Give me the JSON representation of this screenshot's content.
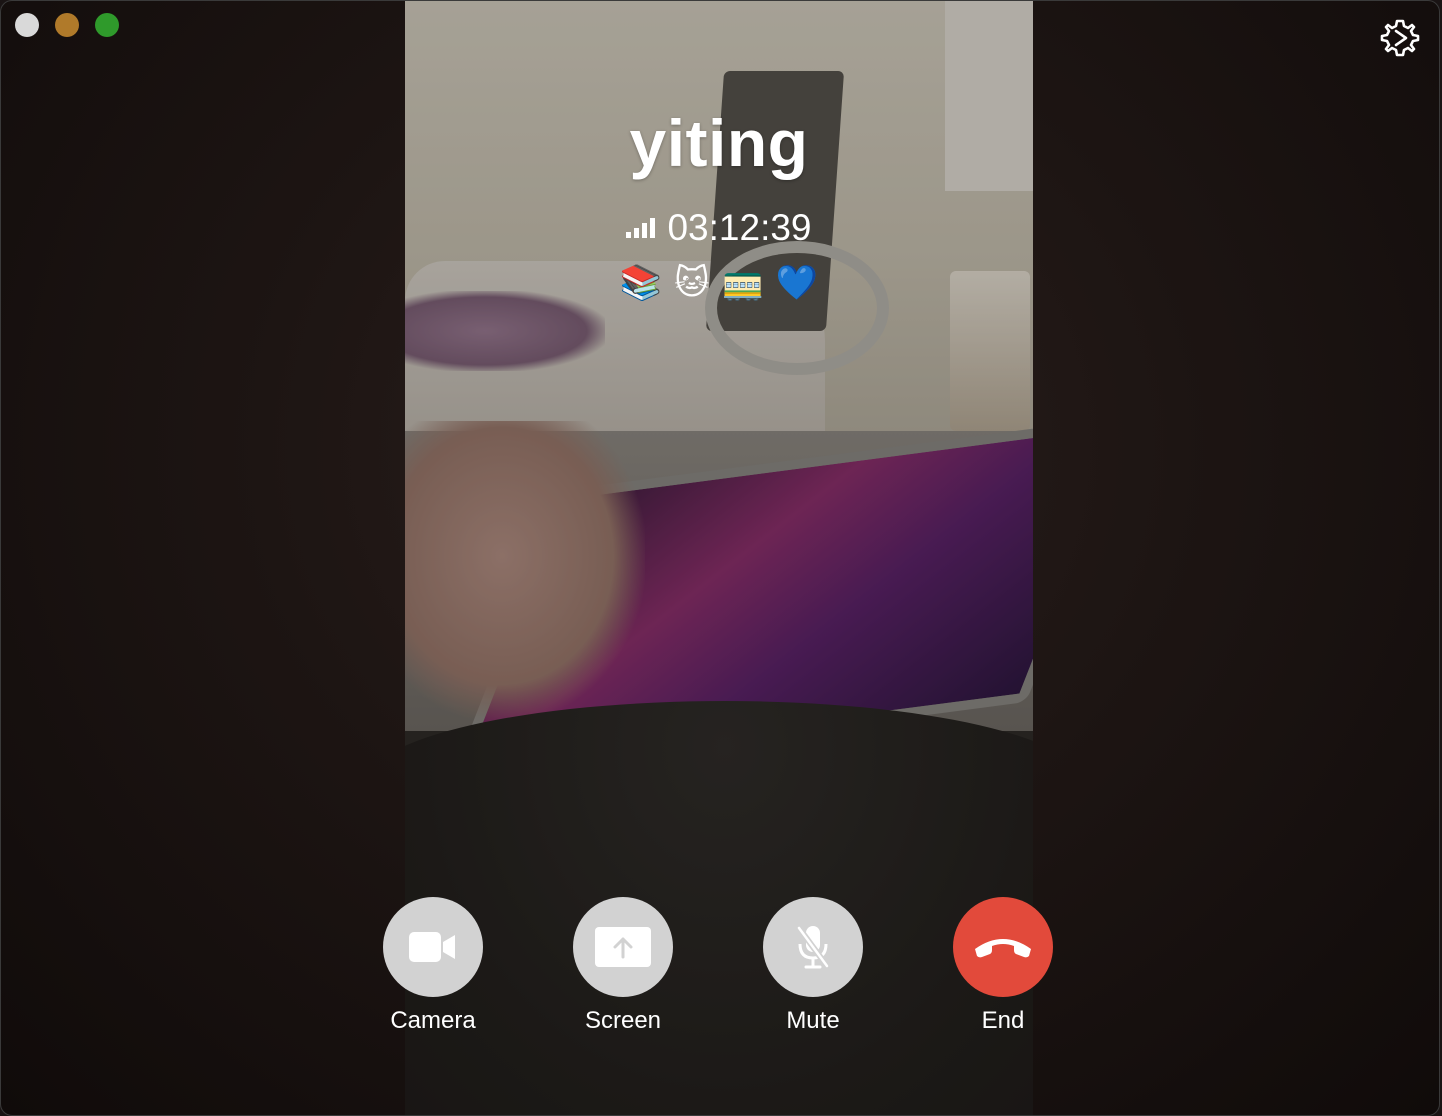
{
  "window": {
    "controls": [
      "close",
      "minimize",
      "maximize"
    ],
    "settings_icon": "gear-icon"
  },
  "call": {
    "caller_name": "yiting",
    "duration": "03:12:39",
    "signal_bars": 4,
    "status_emojis": [
      "📚",
      "🐱",
      "🚃",
      "💙"
    ]
  },
  "controls": [
    {
      "label": "Camera",
      "icon": "video-camera-icon"
    },
    {
      "label": "Screen",
      "icon": "screen-share-icon"
    },
    {
      "label": "Mute",
      "icon": "microphone-slash-icon"
    },
    {
      "label": "End",
      "icon": "phone-hangup-icon"
    }
  ],
  "colors": {
    "control_bg": "#d2d2d2",
    "end_bg": "#e24a3b",
    "text": "#ffffff"
  }
}
